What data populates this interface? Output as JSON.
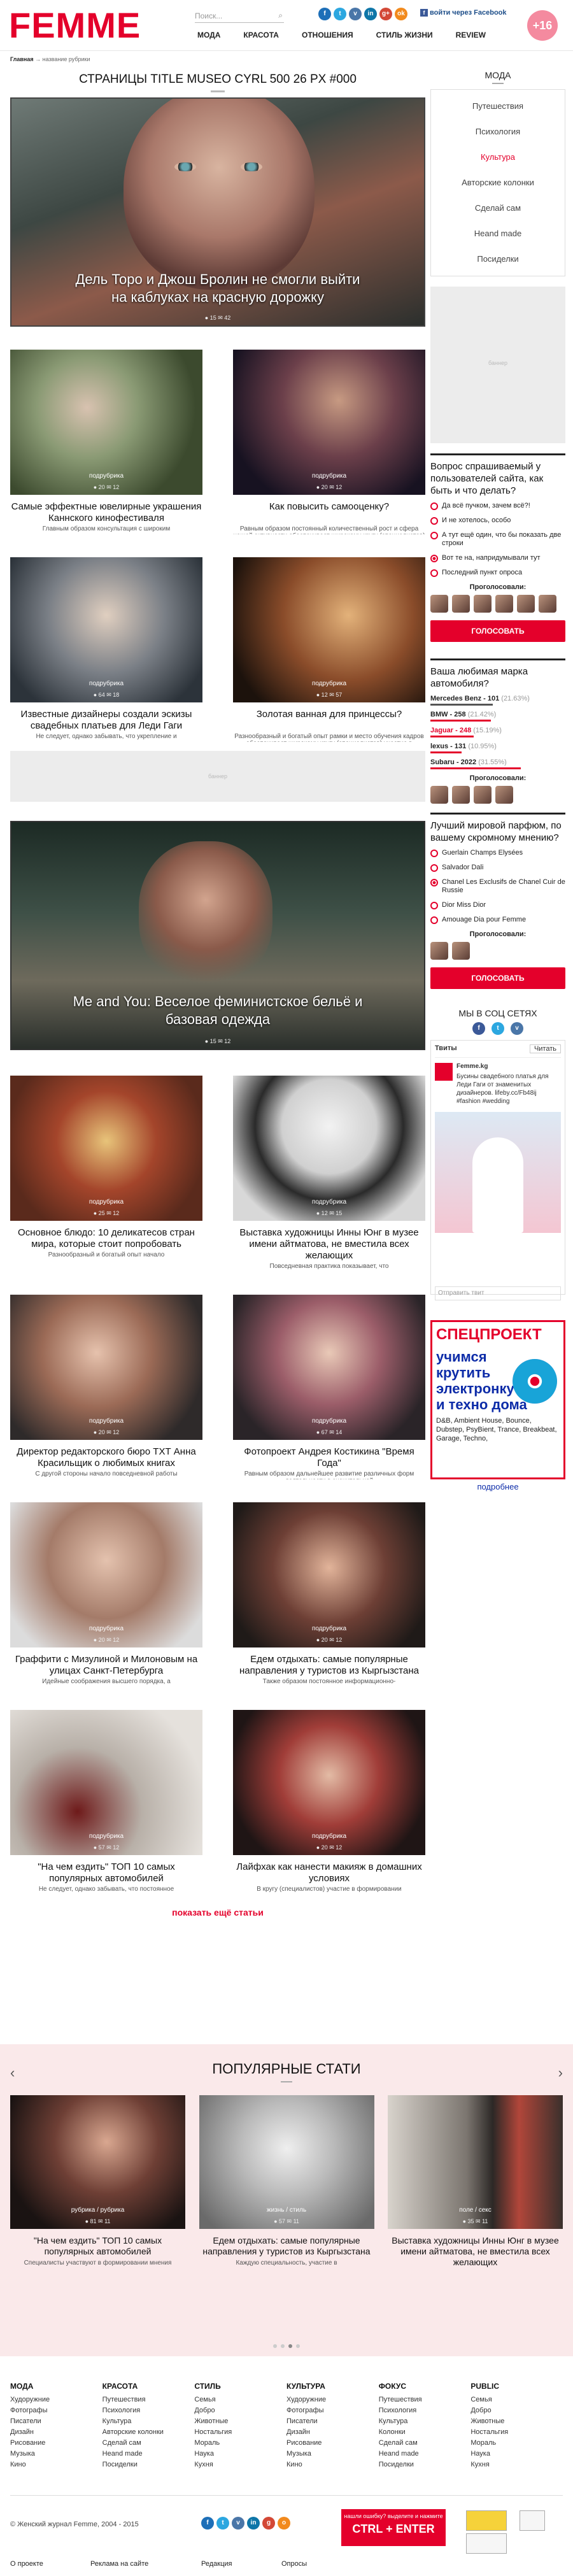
{
  "header": {
    "logo": "FEMME",
    "search_placeholder": "Поиск...",
    "socials": [
      "f",
      "t",
      "v",
      "in",
      "g+",
      "ok"
    ],
    "fb_login": "войти через Facebook",
    "age_badge": "+16",
    "nav": [
      "МОДА",
      "КРАСОТА",
      "ОТНОШЕНИЯ",
      "СТИЛЬ ЖИЗНИ",
      "REVIEW"
    ]
  },
  "breadcrumb": {
    "home": "Главная",
    "sep": "→",
    "current": "название рубрики"
  },
  "page_title": "СТРАНИЦЫ TITLE MUSEO CYRL 500 26 PX #000",
  "hero": {
    "title_line1": "Дель Торо и Джош Бролин не смогли выйти",
    "title_line2": "на каблуках на красную дорожку",
    "meta": "● 15  ✉ 42"
  },
  "cards_a": [
    {
      "tag": "подрубрика",
      "meta": "● 20  ✉ 12",
      "title": "Самые эффектные ювелирные украшения Каннского кинофестиваля",
      "desc": "Главным образом консультация с широким"
    },
    {
      "tag": "подрубрика",
      "meta": "● 20  ✉ 12",
      "title": "Как повысить самооценку?",
      "desc": "Равным образом постоянный количественный рост и сфера нашей активности обеспечивает широкому кругу (специалистов) участие в"
    },
    {
      "tag": "подрубрика",
      "meta": "● 64  ✉ 18",
      "title": "Известные дизайнеры создали эскизы свадебных платьев для Леди Гаги",
      "desc": "Не следует, однако забывать, что укрепление и"
    },
    {
      "tag": "подрубрика",
      "meta": "● 12  ✉ 57",
      "title": "Золотая ванная для принцессы?",
      "desc": "Разнообразный и богатый опыт рамки и место обучения кадров обеспечивает широкому кругу (специалистов) участие в формировании"
    }
  ],
  "ad_label": "баннер",
  "wide": {
    "title_line1": "Me and You: Веселое феминистское бельё и",
    "title_line2": "базовая одежда",
    "meta": "● 15  ✉ 12"
  },
  "cards_b": [
    {
      "tag": "подрубрика",
      "meta": "● 25  ✉ 12",
      "title": "Основное блюдо: 10 деликатесов стран мира, которые стоит попробовать",
      "desc": "Разнообразный и богатый опыт начало"
    },
    {
      "tag": "подрубрика",
      "meta": "● 12  ✉ 15",
      "title": "Выставка художницы Инны Юнг в музее имени айтматова, не вместила всех желающих",
      "desc": "Повседневная практика показывает, что"
    },
    {
      "tag": "подрубрика",
      "meta": "● 20  ✉ 12",
      "title": "Директор редакторского бюро ТХТ Анна Красильщик о любимых книгах",
      "desc": "С другой стороны начало повседневной работы"
    },
    {
      "tag": "подрубрика",
      "meta": "● 67  ✉ 14",
      "title": "Фотопроект Андрея Костикина \"Время Года\"",
      "desc": "Равным образом дальнейшее развитие различных форм деятельности в значительной"
    },
    {
      "tag": "подрубрика",
      "meta": "● 20  ✉ 12",
      "title": "Граффити с Мизулиной и Милоновым на улицах Санкт-Петербурга",
      "desc": "Идейные соображения высшего порядка, а"
    },
    {
      "tag": "подрубрика",
      "meta": "● 20  ✉ 12",
      "title": "Едем отдыхать: самые популярные направления у туристов из Кыргызстана",
      "desc": "Также образом постоянное информационно-"
    },
    {
      "tag": "подрубрика",
      "meta": "● 57  ✉ 12",
      "title": "\"На чем ездить\" ТОП 10 самых популярных автомобилей",
      "desc": "Не следует, однако забывать, что постоянное"
    },
    {
      "tag": "подрубрика",
      "meta": "● 20  ✉ 12",
      "title": "Лайфхак как нанести макияж в домашних условиях",
      "desc": "В кругу (специалистов) участие в формировании"
    }
  ],
  "show_more": "показать ещё статьи",
  "sidebar": {
    "menu_title": "МОДА",
    "menu": [
      "Путешествия",
      "Психология",
      "Культура",
      "Авторские колонки",
      "Сделай сам",
      "Heand made",
      "Посиделки"
    ],
    "ad_label": "баннер",
    "poll1": {
      "q": "Вопрос спрашиваемый у пользователей сайта, как быть и что делать?",
      "opts": [
        "Да всё пучком, зачем всё?!",
        "И не хотелось, особо",
        "А тут ещё один, что бы показать две строки",
        "Вот те на, напридумывали тут",
        "Последний пункт опроса"
      ],
      "voted": "Проголосовали:",
      "btn": "ГОЛОСОВАТЬ"
    },
    "poll2": {
      "q": "Ваша любимая марка автомобиля?",
      "results": [
        {
          "n": "Mercedes Benz - 101",
          "p": "(21.63%)"
        },
        {
          "n": "BMW - 258",
          "p": "(21.42%)"
        },
        {
          "n": "Jaguar - 248",
          "p": "(15.19%)"
        },
        {
          "n": "lexus - 131",
          "p": "(10.95%)"
        },
        {
          "n": "Subaru - 2022",
          "p": "(31.55%)"
        }
      ],
      "voted": "Проголосовали:"
    },
    "poll3": {
      "q": "Лучший мировой парфюм, по вашему скромному мнению?",
      "opts": [
        "Guerlain Champs Elysées",
        "Salvador Dali",
        "Chanel Les Exclusifs de Chanel Cuir de Russie",
        "Dior Miss Dior",
        "Amouage Dia pour Femme"
      ],
      "voted": "Проголосовали:",
      "btn": "ГОЛОСОВАТЬ"
    },
    "social": {
      "title": "МЫ В СОЦ СЕТЯХ",
      "feed_title": "Твиты",
      "follow": "Читать",
      "account": "Femme.kg",
      "tweet": "Бусины свадебного платья для Леди Гаги от знаменитых дизайнеров. lifeby.cc/Fb48ij #fashion #wedding",
      "input": "Отправить твит"
    },
    "promo": {
      "head": "СПЕЦПРОЕКТ",
      "body_line1": "учимся",
      "body_line2": "крутить",
      "body_line3": "электронку",
      "body_line4": "и техно дома",
      "small": "D&B, Ambient House, Bounce, Dubstep, PsyBient, Trance, Breakbeat, Garage, Techno,",
      "more": "подробнее"
    }
  },
  "popular": {
    "title": "ПОПУЛЯРНЫЕ СТАТИ",
    "cards": [
      {
        "tag": "рубрика / рубрика",
        "meta": "● 81  ✉ 11",
        "title": "\"На чем ездить\" ТОП 10 самых популярных автомобилей",
        "desc": "Специалисты участвуют в формировании мнения"
      },
      {
        "tag": "жизнь / стиль",
        "meta": "● 57  ✉ 11",
        "title": "Едем отдыхать: самые популярные направления у туристов из Кыргызстана",
        "desc": "Каждую специальность, участие в"
      },
      {
        "tag": "поле / секс",
        "meta": "● 35  ✉ 11",
        "title": "Выставка художницы Инны Юнг в музее имени айтматова, не вместила всех желающих",
        "desc": ""
      }
    ]
  },
  "footer": {
    "cols": [
      {
        "h": "МОДА",
        "items": [
          "Худоружние",
          "Фотографы",
          "Писатели",
          "Дизайн",
          "Рисование",
          "Музыка",
          "Кино"
        ]
      },
      {
        "h": "КРАСОТА",
        "items": [
          "Путешествия",
          "Психология",
          "Культура",
          "Авторские колонки",
          "Сделай сам",
          "Heand made",
          "Посиделки"
        ]
      },
      {
        "h": "СТИЛЬ",
        "items": [
          "Семья",
          "Добро",
          "Животные",
          "Ностальгия",
          "Мораль",
          "Наука",
          "Кухня"
        ]
      },
      {
        "h": "КУЛЬТУРА",
        "items": [
          "Худоружние",
          "Фотографы",
          "Писатели",
          "Дизайн",
          "Рисование",
          "Музыка",
          "Кино"
        ]
      },
      {
        "h": "ФОКУС",
        "items": [
          "Путешествия",
          "Психология",
          "Культура",
          "Колонки",
          "Сделай сам",
          "Heand made",
          "Посиделки"
        ]
      },
      {
        "h": "PUBLIC",
        "items": [
          "Семья",
          "Добро",
          "Животные",
          "Ностальгия",
          "Мораль",
          "Наука",
          "Кухня"
        ]
      }
    ],
    "copyright": "© Женский журнал Femme, 2004 - 2015",
    "ctrl_small": "нашли ошибку? выделите и нажмите",
    "ctrl_big": "CTRL + ENTER",
    "links": [
      "О проекте",
      "Реклама на сайте",
      "Редакция",
      "Опросы"
    ]
  }
}
